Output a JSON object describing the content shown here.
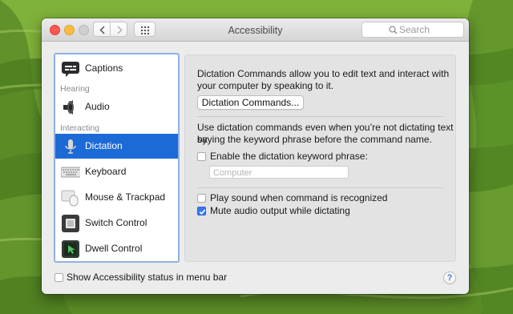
{
  "window": {
    "title": "Accessibility",
    "search_placeholder": "Search"
  },
  "sidebar": {
    "items": [
      {
        "label": "Captions",
        "icon": "captions-icon"
      },
      {
        "label": "Audio",
        "icon": "speaker-icon"
      },
      {
        "label": "Dictation",
        "icon": "microphone-icon",
        "selected": true
      },
      {
        "label": "Keyboard",
        "icon": "keyboard-icon"
      },
      {
        "label": "Mouse & Trackpad",
        "icon": "mouse-trackpad-icon"
      },
      {
        "label": "Switch Control",
        "icon": "switch-control-icon"
      },
      {
        "label": "Dwell Control",
        "icon": "dwell-control-icon"
      }
    ],
    "headers": [
      "Hearing",
      "Interacting"
    ]
  },
  "panel": {
    "intro_line1": "Dictation Commands allow you to edit text and interact with",
    "intro_line2": "your computer by speaking to it.",
    "commands_button": "Dictation Commands...",
    "desc_line1": "Use dictation commands even when you’re not dictating text by",
    "desc_line2": "saying the keyword phrase before the command name.",
    "enable_keyword_label": "Enable the dictation keyword phrase:",
    "enable_keyword_checked": false,
    "keyword_placeholder": "Computer",
    "play_sound_label": "Play sound when command is recognized",
    "play_sound_checked": false,
    "mute_audio_label": "Mute audio output while dictating",
    "mute_audio_checked": true
  },
  "footer": {
    "show_status_label": "Show Accessibility status in menu bar",
    "show_status_checked": false,
    "help_label": "?"
  },
  "colors": {
    "selection": "#1c6ad6",
    "checkbox_on": "#3478f6"
  }
}
